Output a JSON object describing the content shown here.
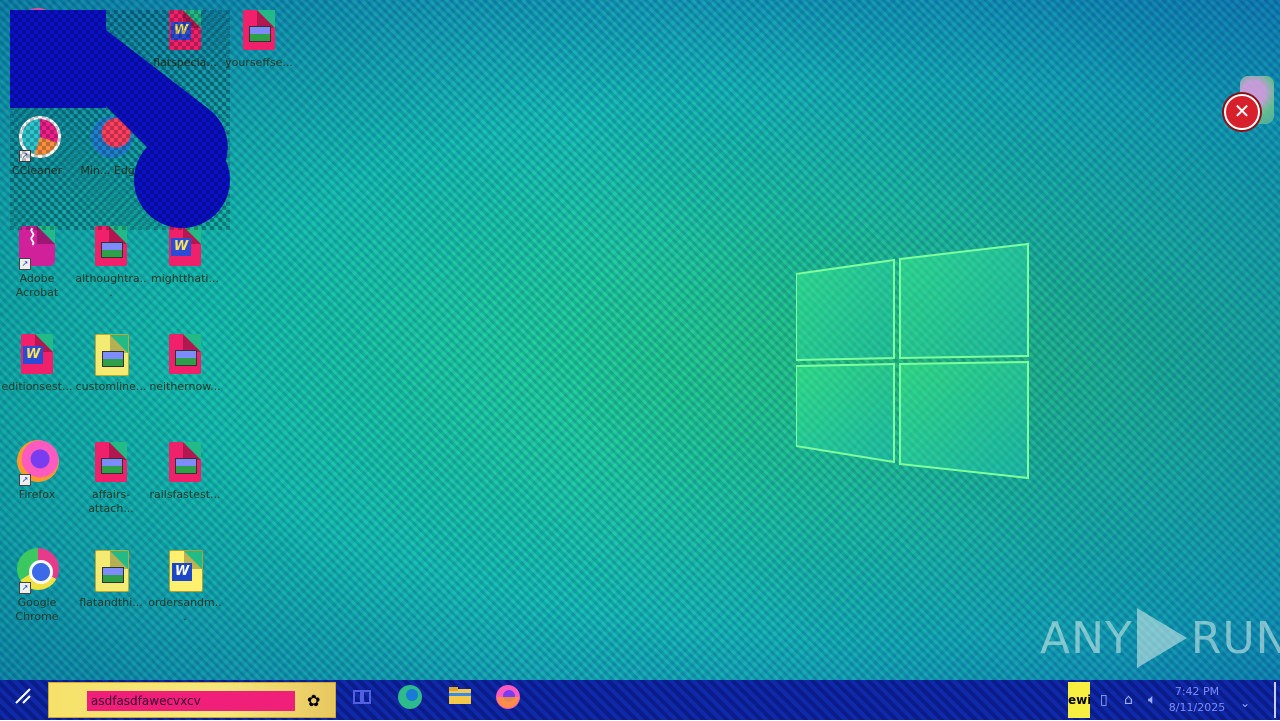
{
  "desktop": {
    "icons": [
      {
        "label": "",
        "type": "app-pink"
      },
      {
        "label": "flatspecia...",
        "type": "word-pink"
      },
      {
        "label": "yourseffse...",
        "type": "img-pink"
      },
      {
        "label": "CCleaner",
        "type": "ccleaner"
      },
      {
        "label": "Min... Edge",
        "type": "edge"
      },
      {
        "label": "Adobe Acrobat",
        "type": "acrobat"
      },
      {
        "label": "althoughtra...",
        "type": "img-pink"
      },
      {
        "label": "mightthati...",
        "type": "word-pink"
      },
      {
        "label": "editionsest...",
        "type": "word-pink"
      },
      {
        "label": "customline...",
        "type": "img-yellow"
      },
      {
        "label": "neithernow...",
        "type": "img-pink"
      },
      {
        "label": "Firefox",
        "type": "firefox"
      },
      {
        "label": "affairs-attach...",
        "type": "img-pink"
      },
      {
        "label": "railsfastest...",
        "type": "img-pink"
      },
      {
        "label": "Google Chrome",
        "type": "chrome"
      },
      {
        "label": "flatandthi...",
        "type": "img-yellow"
      },
      {
        "label": "ordersandm...",
        "type": "word-yellow"
      }
    ]
  },
  "watermark": {
    "left": "ANY",
    "right": "RUN"
  },
  "colors": {
    "accent": "#f0207a",
    "taskbar": "#1029a8",
    "close": "#d8202c"
  },
  "taskbar": {
    "start_icon": "windows-start-icon",
    "search_value": "asdfasdfawecvxcv",
    "pinned": [
      {
        "name": "task-view-icon"
      },
      {
        "name": "edge-icon"
      },
      {
        "name": "file-explorer-icon"
      },
      {
        "name": "firefox-icon"
      }
    ],
    "tray_label": "ewi",
    "time": "7:42 PM",
    "date": "8/11/2025"
  }
}
